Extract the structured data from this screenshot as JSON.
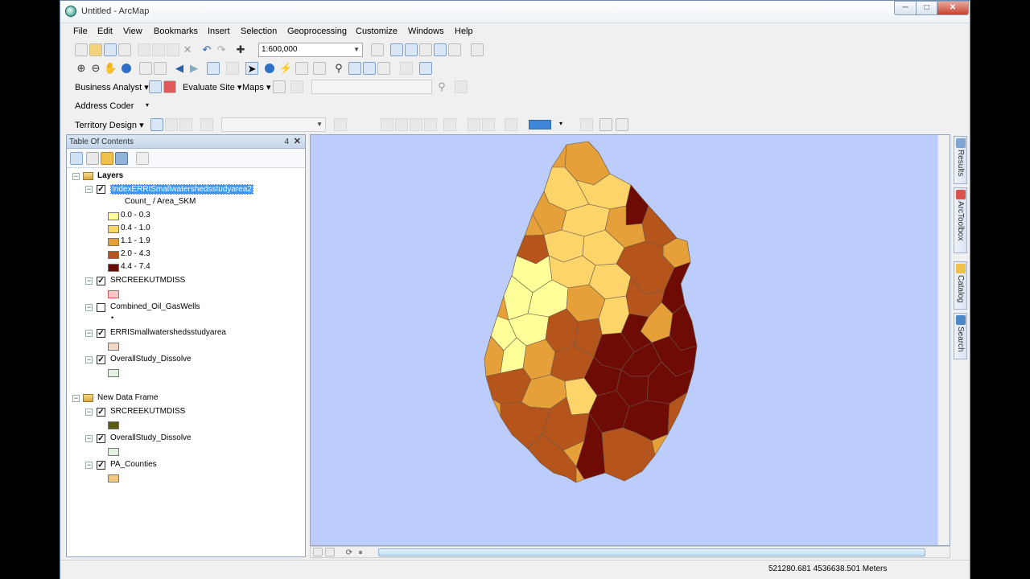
{
  "window": {
    "title": "Untitled - ArcMap",
    "minimize": "─",
    "maximize": "□",
    "close": "✕"
  },
  "menu": [
    "File",
    "Edit",
    "View",
    "Bookmarks",
    "Insert",
    "Selection",
    "Geoprocessing",
    "Customize",
    "Windows",
    "Help"
  ],
  "toolbar": {
    "scale": "1:600,000",
    "business_analyst_label": "Business Analyst ▾",
    "evaluate_site_label": "Evaluate Site ▾",
    "maps_label": "Maps ▾",
    "address_coder_label": "Address Coder",
    "territory_design_label": "Territory Design ▾"
  },
  "toc": {
    "title": "Table Of Contents",
    "pin": "4",
    "close": "✕",
    "data_frame_1": "Layers",
    "selected_layer": "IndexERRISmallwatershedsstudyarea2",
    "legend_heading": "Count_ / Area_SKM",
    "classes": [
      {
        "label": "0.0 - 0.3",
        "color": "#ffff99"
      },
      {
        "label": "0.4 - 1.0",
        "color": "#fcd46a"
      },
      {
        "label": "1.1 - 1.9",
        "color": "#e6a03a"
      },
      {
        "label": "2.0 - 4.3",
        "color": "#b5541b"
      },
      {
        "label": "4.4 - 7.4",
        "color": "#6e0b05"
      }
    ],
    "layers_1": [
      {
        "name": "SRCREEKUTMDISS",
        "checked": true,
        "swatch": "#f2c9c9"
      },
      {
        "name": "Combined_Oil_GasWells",
        "checked": false,
        "swatch": ""
      },
      {
        "name": "ERRISmallwatershedsstudyarea",
        "checked": true,
        "swatch": "#f1d7c4"
      },
      {
        "name": "OverallStudy_Dissolve",
        "checked": true,
        "swatch": "#e3f1e0"
      }
    ],
    "data_frame_2": "New Data Frame",
    "layers_2": [
      {
        "name": "SRCREEKUTMDISS",
        "checked": true,
        "swatch": "#5a5d0d"
      },
      {
        "name": "OverallStudy_Dissolve",
        "checked": true,
        "swatch": "#e3f1e0"
      },
      {
        "name": "PA_Counties",
        "checked": true,
        "swatch": "#f1c67e"
      }
    ]
  },
  "side_tabs": [
    "Results",
    "ArcToolbox",
    "Catalog",
    "Search"
  ],
  "status": {
    "coordinates": "521280.681  4536638.501 Meters"
  },
  "map_colors": {
    "background": "#bccdfb",
    "outline": "#6b5a4a"
  }
}
